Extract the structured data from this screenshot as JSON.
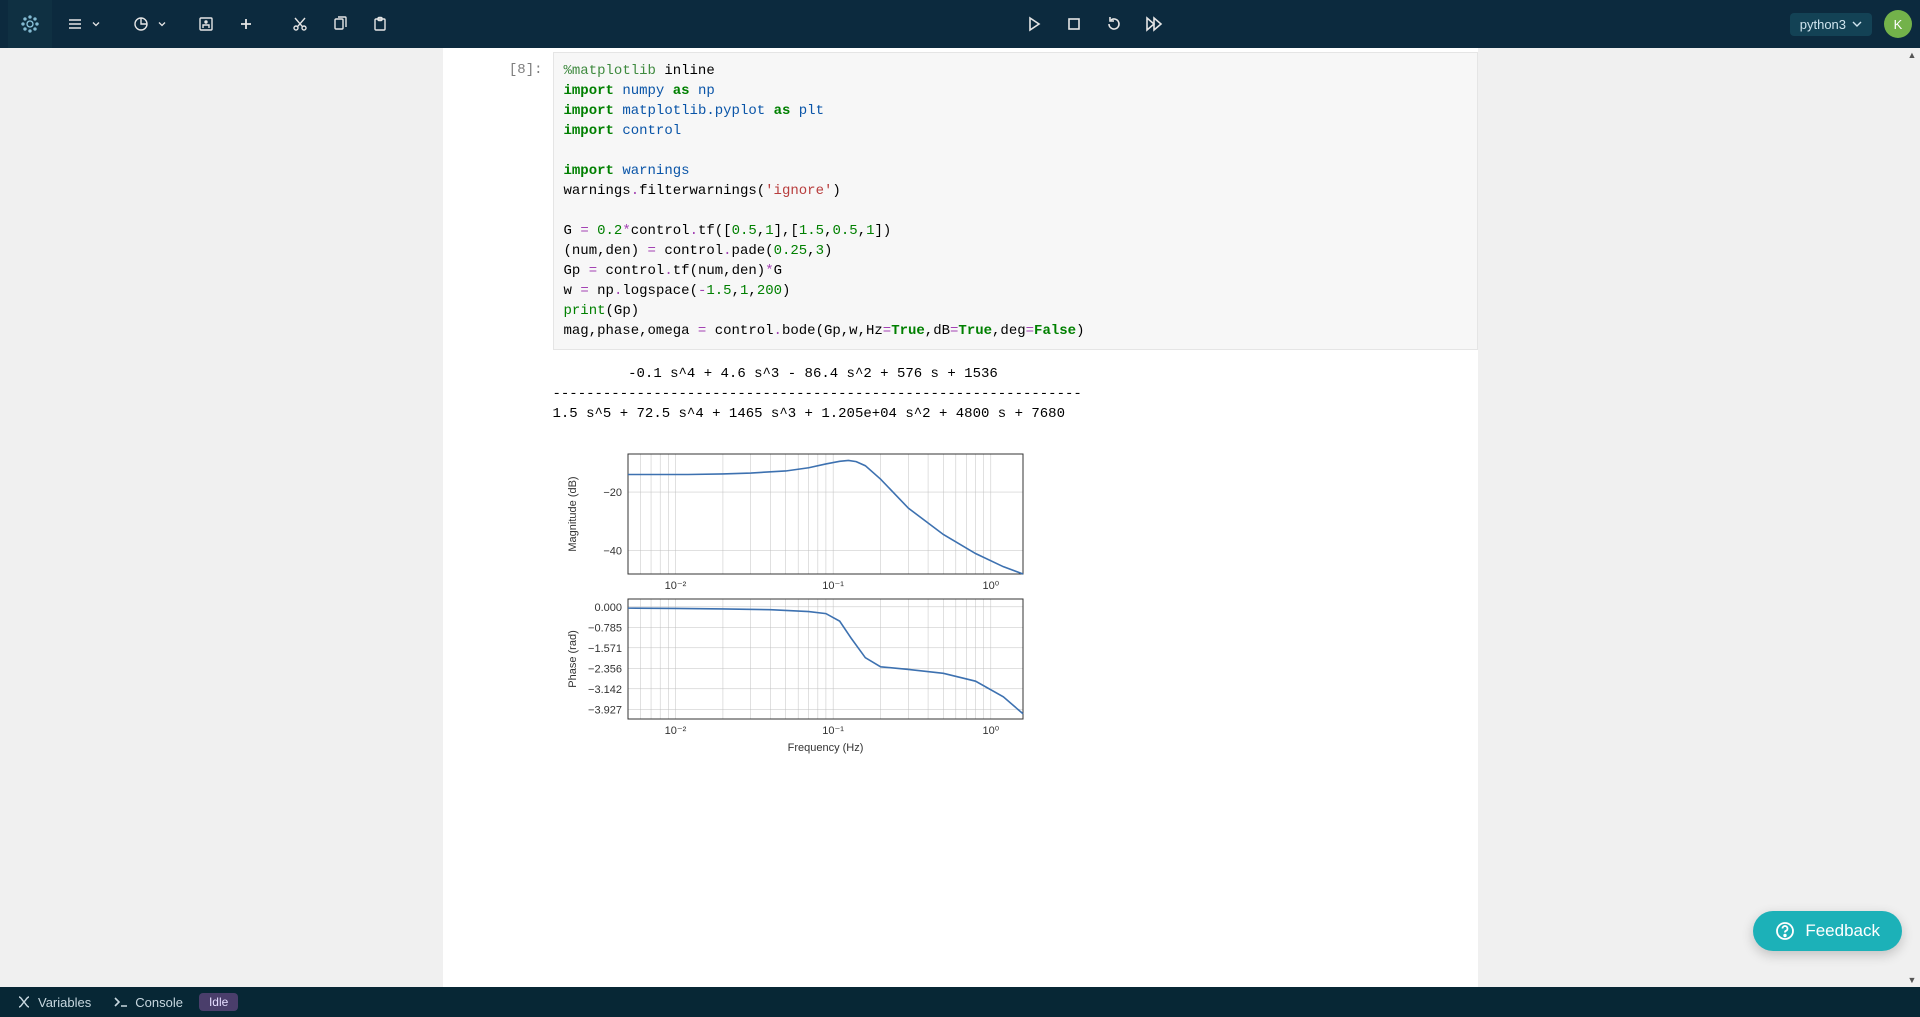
{
  "kernel": {
    "name": "python3",
    "avatar_letter": "K"
  },
  "statusbar": {
    "variables": "Variables",
    "console": "Console",
    "status": "Idle"
  },
  "feedback": {
    "label": "Feedback"
  },
  "cell": {
    "prompt": "[8]:",
    "code_tokens": [
      [
        [
          "magic",
          "%"
        ],
        [
          "magic",
          "matplotlib"
        ],
        [
          "name",
          " inline"
        ]
      ],
      [
        [
          "kw",
          "import"
        ],
        [
          "name",
          " "
        ],
        [
          "nn",
          "numpy"
        ],
        [
          "name",
          " "
        ],
        [
          "kw",
          "as"
        ],
        [
          "name",
          " "
        ],
        [
          "nn",
          "np"
        ]
      ],
      [
        [
          "kw",
          "import"
        ],
        [
          "name",
          " "
        ],
        [
          "nn",
          "matplotlib.pyplot"
        ],
        [
          "name",
          " "
        ],
        [
          "kw",
          "as"
        ],
        [
          "name",
          " "
        ],
        [
          "nn",
          "plt"
        ]
      ],
      [
        [
          "kw",
          "import"
        ],
        [
          "name",
          " "
        ],
        [
          "nn",
          "control"
        ]
      ],
      [],
      [
        [
          "kw",
          "import"
        ],
        [
          "name",
          " "
        ],
        [
          "nn",
          "warnings"
        ]
      ],
      [
        [
          "name",
          "warnings"
        ],
        [
          "op",
          "."
        ],
        [
          "name",
          "filterwarnings"
        ],
        [
          "name",
          "("
        ],
        [
          "str",
          "'ignore'"
        ],
        [
          "name",
          ")"
        ]
      ],
      [],
      [
        [
          "name",
          "G "
        ],
        [
          "op",
          "="
        ],
        [
          "name",
          " "
        ],
        [
          "num",
          "0.2"
        ],
        [
          "op",
          "*"
        ],
        [
          "name",
          "control"
        ],
        [
          "op",
          "."
        ],
        [
          "name",
          "tf"
        ],
        [
          "name",
          "(["
        ],
        [
          "num",
          "0.5"
        ],
        [
          "name",
          ","
        ],
        [
          "num",
          "1"
        ],
        [
          "name",
          "],["
        ],
        [
          "num",
          "1.5"
        ],
        [
          "name",
          ","
        ],
        [
          "num",
          "0.5"
        ],
        [
          "name",
          ","
        ],
        [
          "num",
          "1"
        ],
        [
          "name",
          "])"
        ]
      ],
      [
        [
          "name",
          "(num,den) "
        ],
        [
          "op",
          "="
        ],
        [
          "name",
          " control"
        ],
        [
          "op",
          "."
        ],
        [
          "name",
          "pade"
        ],
        [
          "name",
          "("
        ],
        [
          "num",
          "0.25"
        ],
        [
          "name",
          ","
        ],
        [
          "num",
          "3"
        ],
        [
          "name",
          ")"
        ]
      ],
      [
        [
          "name",
          "Gp "
        ],
        [
          "op",
          "="
        ],
        [
          "name",
          " control"
        ],
        [
          "op",
          "."
        ],
        [
          "name",
          "tf"
        ],
        [
          "name",
          "(num,den)"
        ],
        [
          "op",
          "*"
        ],
        [
          "name",
          "G"
        ]
      ],
      [
        [
          "name",
          "w "
        ],
        [
          "op",
          "="
        ],
        [
          "name",
          " np"
        ],
        [
          "op",
          "."
        ],
        [
          "name",
          "logspace"
        ],
        [
          "name",
          "("
        ],
        [
          "op",
          "-"
        ],
        [
          "num",
          "1.5"
        ],
        [
          "name",
          ","
        ],
        [
          "num",
          "1"
        ],
        [
          "name",
          ","
        ],
        [
          "num",
          "200"
        ],
        [
          "name",
          ")"
        ]
      ],
      [
        [
          "builtin",
          "print"
        ],
        [
          "name",
          "(Gp)"
        ]
      ],
      [
        [
          "name",
          "mag,phase,omega "
        ],
        [
          "op",
          "="
        ],
        [
          "name",
          " control"
        ],
        [
          "op",
          "."
        ],
        [
          "name",
          "bode"
        ],
        [
          "name",
          "(Gp,w,Hz"
        ],
        [
          "op",
          "="
        ],
        [
          "const",
          "True"
        ],
        [
          "name",
          ",dB"
        ],
        [
          "op",
          "="
        ],
        [
          "const",
          "True"
        ],
        [
          "name",
          ",deg"
        ],
        [
          "op",
          "="
        ],
        [
          "const",
          "False"
        ],
        [
          "name",
          ")"
        ]
      ]
    ],
    "text_output": "         -0.1 s^4 + 4.6 s^3 - 86.4 s^2 + 576 s + 1536\n---------------------------------------------------------------\n1.5 s^5 + 72.5 s^4 + 1465 s^3 + 1.205e+04 s^2 + 4800 s + 7680"
  },
  "chart_data": [
    {
      "type": "line",
      "title": "",
      "xscale": "log",
      "xlabel": "",
      "ylabel": "Magnitude (dB)",
      "xlim": [
        0.005,
        1.6
      ],
      "ylim": [
        -48,
        -7
      ],
      "yticks": [
        -20,
        -40
      ],
      "x": [
        0.005,
        0.008,
        0.012,
        0.02,
        0.03,
        0.05,
        0.07,
        0.09,
        0.11,
        0.125,
        0.14,
        0.16,
        0.2,
        0.3,
        0.5,
        0.8,
        1.2,
        1.6
      ],
      "values": [
        -14,
        -14,
        -14,
        -13.8,
        -13.5,
        -12.8,
        -11.7,
        -10.4,
        -9.5,
        -9.2,
        -9.6,
        -11.0,
        -15.6,
        -25.5,
        -34.5,
        -41.0,
        -45.5,
        -48.0
      ]
    },
    {
      "type": "line",
      "title": "",
      "xscale": "log",
      "xlabel": "Frequency (Hz)",
      "ylabel": "Phase (rad)",
      "xlim": [
        0.005,
        1.6
      ],
      "ylim": [
        -4.3,
        0.3
      ],
      "yticks": [
        0.0,
        -0.785,
        -1.571,
        -2.356,
        -3.142,
        -3.927
      ],
      "xticks_labels": [
        "10⁻²",
        "10⁻¹",
        "10⁰"
      ],
      "xticks_vals": [
        0.01,
        0.1,
        1.0
      ],
      "x": [
        0.005,
        0.01,
        0.02,
        0.04,
        0.07,
        0.09,
        0.11,
        0.13,
        0.16,
        0.2,
        0.3,
        0.5,
        0.8,
        1.2,
        1.6
      ],
      "values": [
        -0.05,
        -0.06,
        -0.08,
        -0.11,
        -0.18,
        -0.26,
        -0.55,
        -1.2,
        -1.95,
        -2.3,
        -2.4,
        -2.55,
        -2.85,
        -3.45,
        -4.1
      ]
    }
  ]
}
